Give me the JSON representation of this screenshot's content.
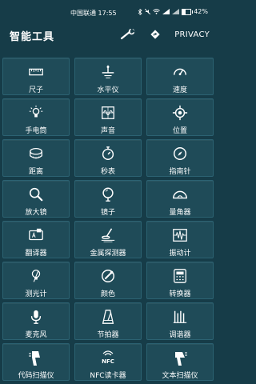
{
  "status": {
    "carrier_time": "中国联通 17:55",
    "battery_text": "42%",
    "battery_level": 0.42
  },
  "app": {
    "title": "智能工具",
    "privacy_label": "PRIVACY"
  },
  "tools": [
    {
      "label": "尺子",
      "icon": "ruler-icon"
    },
    {
      "label": "水平仪",
      "icon": "level-icon"
    },
    {
      "label": "速度",
      "icon": "speedometer-icon"
    },
    {
      "label": "手电筒",
      "icon": "flashlight-icon"
    },
    {
      "label": "声音",
      "icon": "sound-icon"
    },
    {
      "label": "位置",
      "icon": "location-icon"
    },
    {
      "label": "距离",
      "icon": "tape-measure-icon"
    },
    {
      "label": "秒表",
      "icon": "stopwatch-icon"
    },
    {
      "label": "指南针",
      "icon": "compass-icon"
    },
    {
      "label": "放大镜",
      "icon": "magnifier-icon"
    },
    {
      "label": "镜子",
      "icon": "mirror-icon"
    },
    {
      "label": "量角器",
      "icon": "protractor-icon"
    },
    {
      "label": "翻译器",
      "icon": "translator-icon"
    },
    {
      "label": "金属探测器",
      "icon": "metal-detector-icon"
    },
    {
      "label": "振动计",
      "icon": "vibration-icon"
    },
    {
      "label": "测光计",
      "icon": "light-meter-icon"
    },
    {
      "label": "颜色",
      "icon": "color-picker-icon"
    },
    {
      "label": "转换器",
      "icon": "converter-icon"
    },
    {
      "label": "麦克风",
      "icon": "microphone-icon"
    },
    {
      "label": "节拍器",
      "icon": "metronome-icon"
    },
    {
      "label": "调谐器",
      "icon": "tuner-icon"
    },
    {
      "label": "代码扫描仪",
      "icon": "barcode-scanner-icon"
    },
    {
      "label": "NFC读卡器",
      "icon": "nfc-icon"
    },
    {
      "label": "文本扫描仪",
      "icon": "text-scanner-icon"
    }
  ]
}
